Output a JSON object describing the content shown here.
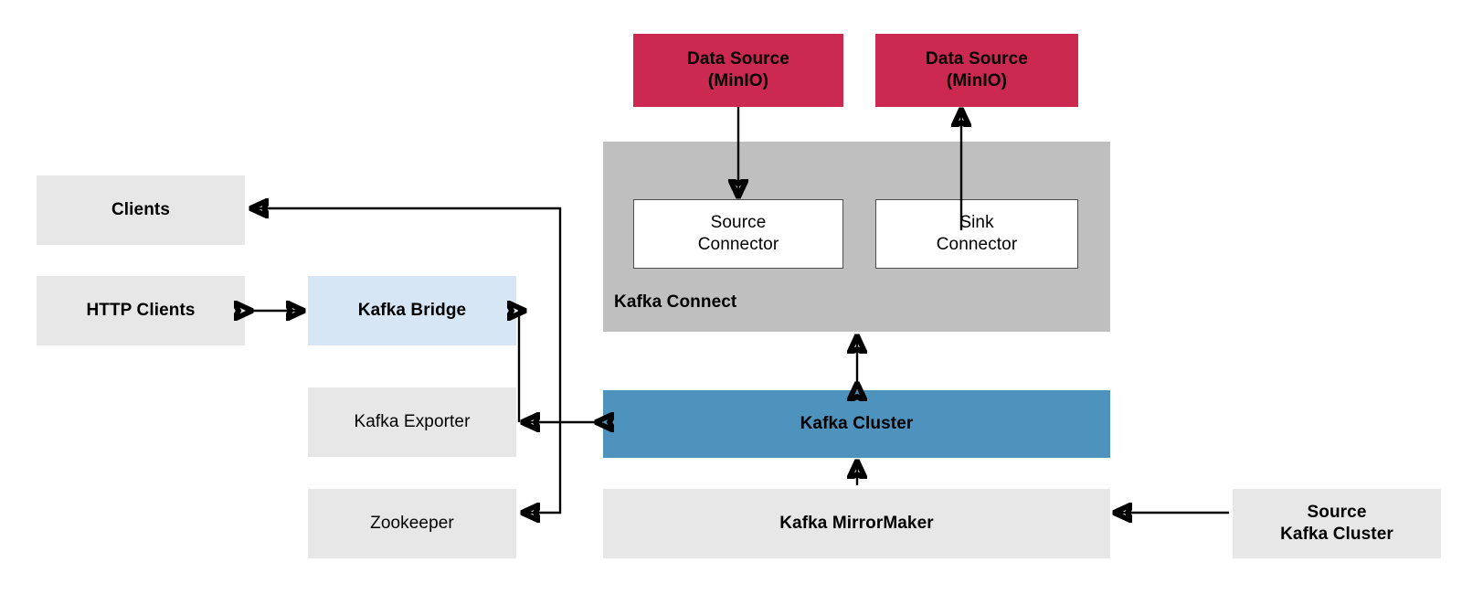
{
  "diagram": {
    "title": "Strimzi Kafka components architecture",
    "colors": {
      "grey": "#e7e7e7",
      "red": "#cc2950",
      "blue": "#4e92be",
      "light_blue": "#d6e6f5",
      "container_grey": "#bfbfbf",
      "white": "#ffffff",
      "line": "#000000"
    }
  },
  "groups": {
    "kafka_connect": {
      "label": "Kafka Connect"
    }
  },
  "nodes": {
    "data_source_left": "Data Source\n(MinIO)",
    "data_source_right": "Data Source\n(MinIO)",
    "source_connector": "Source\nConnector",
    "sink_connector": "Sink\nConnector",
    "clients": "Clients",
    "http_clients": "HTTP Clients",
    "kafka_bridge": "Kafka Bridge",
    "kafka_exporter": "Kafka Exporter",
    "zookeeper": "Zookeeper",
    "kafka_cluster": "Kafka Cluster",
    "kafka_mirrormaker": "Kafka MirrorMaker",
    "source_kafka_cluster": "Source\nKafka Cluster"
  },
  "edges": [
    {
      "name": "data-source-left-to-source-connector",
      "from": "data_source_left",
      "to": "source_connector",
      "direction": "one-way"
    },
    {
      "name": "sink-connector-to-data-source-right",
      "from": "sink_connector",
      "to": "data_source_right",
      "direction": "one-way"
    },
    {
      "name": "kafka-connect-to-kafka-cluster",
      "from": "kafka_connect",
      "to": "kafka_cluster",
      "direction": "two-way"
    },
    {
      "name": "kafka-cluster-to-clients",
      "from": "kafka_cluster",
      "to": "clients",
      "direction": "one-way"
    },
    {
      "name": "http-clients-to-kafka-bridge",
      "from": "http_clients",
      "to": "kafka_bridge",
      "direction": "two-way"
    },
    {
      "name": "kafka-cluster-to-kafka-bridge",
      "from": "kafka_cluster",
      "to": "kafka_bridge",
      "direction": "one-way"
    },
    {
      "name": "kafka-cluster-to-kafka-exporter",
      "from": "kafka_cluster",
      "to": "kafka_exporter",
      "direction": "two-way"
    },
    {
      "name": "kafka-cluster-to-zookeeper",
      "from": "kafka_cluster",
      "to": "zookeeper",
      "direction": "one-way"
    },
    {
      "name": "kafka-mirrormaker-to-kafka-cluster",
      "from": "kafka_mirrormaker",
      "to": "kafka_cluster",
      "direction": "one-way"
    },
    {
      "name": "source-kafka-cluster-to-kafka-mirrormaker",
      "from": "source_kafka_cluster",
      "to": "kafka_mirrormaker",
      "direction": "one-way"
    }
  ]
}
